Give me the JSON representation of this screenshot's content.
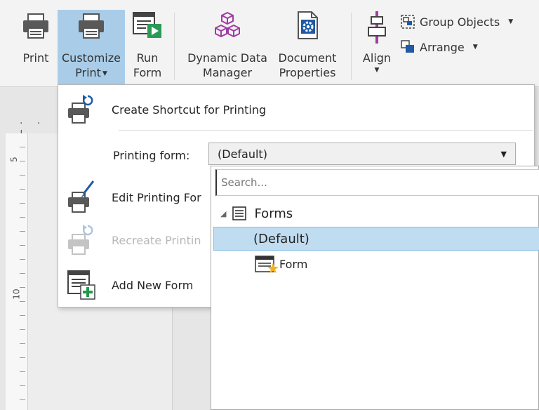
{
  "ribbon": {
    "print": "Print",
    "customize_print_l1": "Customize",
    "customize_print_l2": "Print",
    "run_form_l1": "Run",
    "run_form_l2": "Form",
    "ddm_l1": "Dynamic Data",
    "ddm_l2": "Manager",
    "doc_props_l1": "Document",
    "doc_props_l2": "Properties",
    "align": "Align",
    "group_objects": "Group Objects",
    "arrange": "Arrange"
  },
  "menu": {
    "create_shortcut": "Create Shortcut for Printing",
    "printing_form_label": "Printing form:",
    "printing_form_value": "(Default)",
    "edit_printing_form": "Edit Printing For",
    "recreate_printing": "Recreate Printin",
    "add_new_form": "Add New Form"
  },
  "popup": {
    "search_placeholder": "Search...",
    "tree_root": "Forms",
    "tree_default": "(Default)",
    "tree_form": "Form"
  },
  "colors": {
    "accent_selected": "#a9cde8",
    "tree_selection": "#c0dcf0",
    "printer_blue": "#2a5fa8",
    "form_green": "#1f9a4a",
    "ddm_purple": "#a23aa3"
  }
}
